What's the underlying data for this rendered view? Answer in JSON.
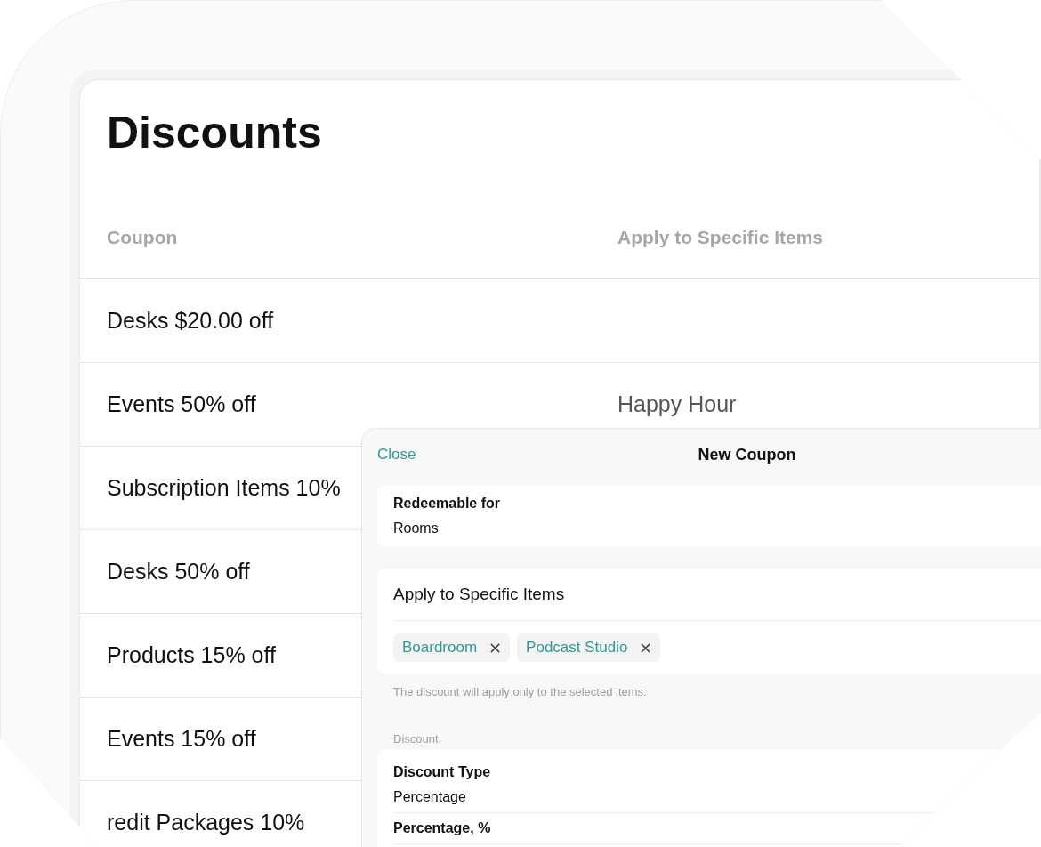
{
  "page": {
    "title": "Discounts"
  },
  "table": {
    "columns": [
      "Coupon",
      "Apply to Specific Items"
    ],
    "rows": [
      {
        "coupon": "Desks $20.00 off"
      },
      {
        "coupon": "Events 50% off",
        "items": "Happy Hour"
      },
      {
        "coupon": "Subscription Items 10%"
      },
      {
        "coupon": "Desks 50% off"
      },
      {
        "coupon": "Products 15% off"
      },
      {
        "coupon": "Events 15% off"
      },
      {
        "coupon": "redit Packages 10%"
      }
    ]
  },
  "modal": {
    "close": "Close",
    "title": "New Coupon",
    "redeemable": {
      "label": "Redeemable for",
      "value": "Rooms"
    },
    "items": {
      "label": "Apply to Specific Items",
      "chips": [
        "Boardroom",
        "Podcast Studio"
      ],
      "hint": "The discount will apply only to the selected items."
    },
    "discount": {
      "section": "Discount",
      "fields": [
        {
          "label": "Discount Type",
          "value": "Percentage"
        },
        {
          "label": "Percentage, %"
        }
      ]
    }
  }
}
